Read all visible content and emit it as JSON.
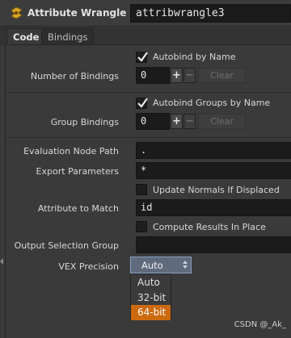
{
  "header": {
    "node_type": "Attribute Wrangle",
    "node_name": "attribwrangle3",
    "icon": "wrangle-node-icon"
  },
  "tabs": [
    {
      "label": "Code",
      "active": true
    },
    {
      "label": "Bindings",
      "active": false
    }
  ],
  "params": {
    "autobind": {
      "label": "Autobind by Name",
      "checked": true
    },
    "num_bindings": {
      "label": "Number of Bindings",
      "value": "0",
      "plus": "+",
      "minus": "−",
      "clear": "Clear"
    },
    "autobind_groups": {
      "label": "Autobind Groups by Name",
      "checked": true
    },
    "group_bindings": {
      "label": "Group Bindings",
      "value": "0",
      "plus": "+",
      "minus": "−",
      "clear": "Clear"
    },
    "eval_node_path": {
      "label": "Evaluation Node Path",
      "value": "."
    },
    "export_params": {
      "label": "Export Parameters",
      "value": "*"
    },
    "update_normals": {
      "label": "Update Normals If Displaced",
      "checked": false
    },
    "attr_to_match": {
      "label": "Attribute to Match",
      "value": "id"
    },
    "compute_in_place": {
      "label": "Compute Results In Place",
      "checked": false
    },
    "output_sel_group": {
      "label": "Output Selection Group",
      "value": ""
    },
    "vex_precision": {
      "label": "VEX Precision",
      "selected": "Auto",
      "options": [
        "Auto",
        "32-bit",
        "64-bit"
      ],
      "highlighted": "64-bit"
    }
  },
  "watermark": "CSDN @_Ak_",
  "colors": {
    "highlight": "#cc6a0d",
    "dropdown": "#5f6a7d",
    "field_bg": "#1b1b1b",
    "panel_bg": "#3a3a3a"
  }
}
